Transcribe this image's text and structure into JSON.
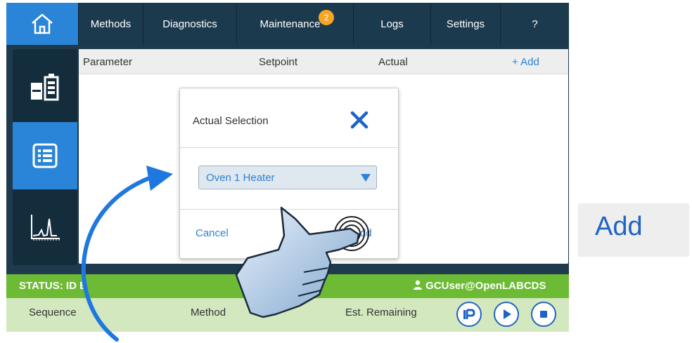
{
  "nav": {
    "tabs": [
      {
        "label": "Methods"
      },
      {
        "label": "Diagnostics"
      },
      {
        "label": "Maintenance",
        "badge": "2"
      },
      {
        "label": "Logs"
      },
      {
        "label": "Settings"
      },
      {
        "label": "?"
      }
    ]
  },
  "sidebar": {
    "items": [
      {
        "icon": "instrument-status-icon"
      },
      {
        "icon": "list-icon",
        "active": true
      },
      {
        "icon": "chromatogram-icon"
      }
    ]
  },
  "table": {
    "columns": {
      "parameter": "Parameter",
      "setpoint": "Setpoint",
      "actual": "Actual"
    },
    "add_label": "+ Add"
  },
  "modal": {
    "title": "Actual Selection",
    "select_value": "Oven 1 Heater",
    "cancel_label": "Cancel",
    "add_label": "dd"
  },
  "status": {
    "text": "STATUS: ID E",
    "user": "GCUser@OpenLABCDS"
  },
  "info": {
    "sequence_label": "Sequence",
    "method_label": "Method",
    "remaining_label": "Est. Remaining"
  },
  "callout": {
    "text": "Add"
  },
  "colors": {
    "accent": "#2a84d8",
    "nav_bg": "#1c3a4e",
    "status_green": "#6dbb35",
    "badge": "#f5a623"
  }
}
